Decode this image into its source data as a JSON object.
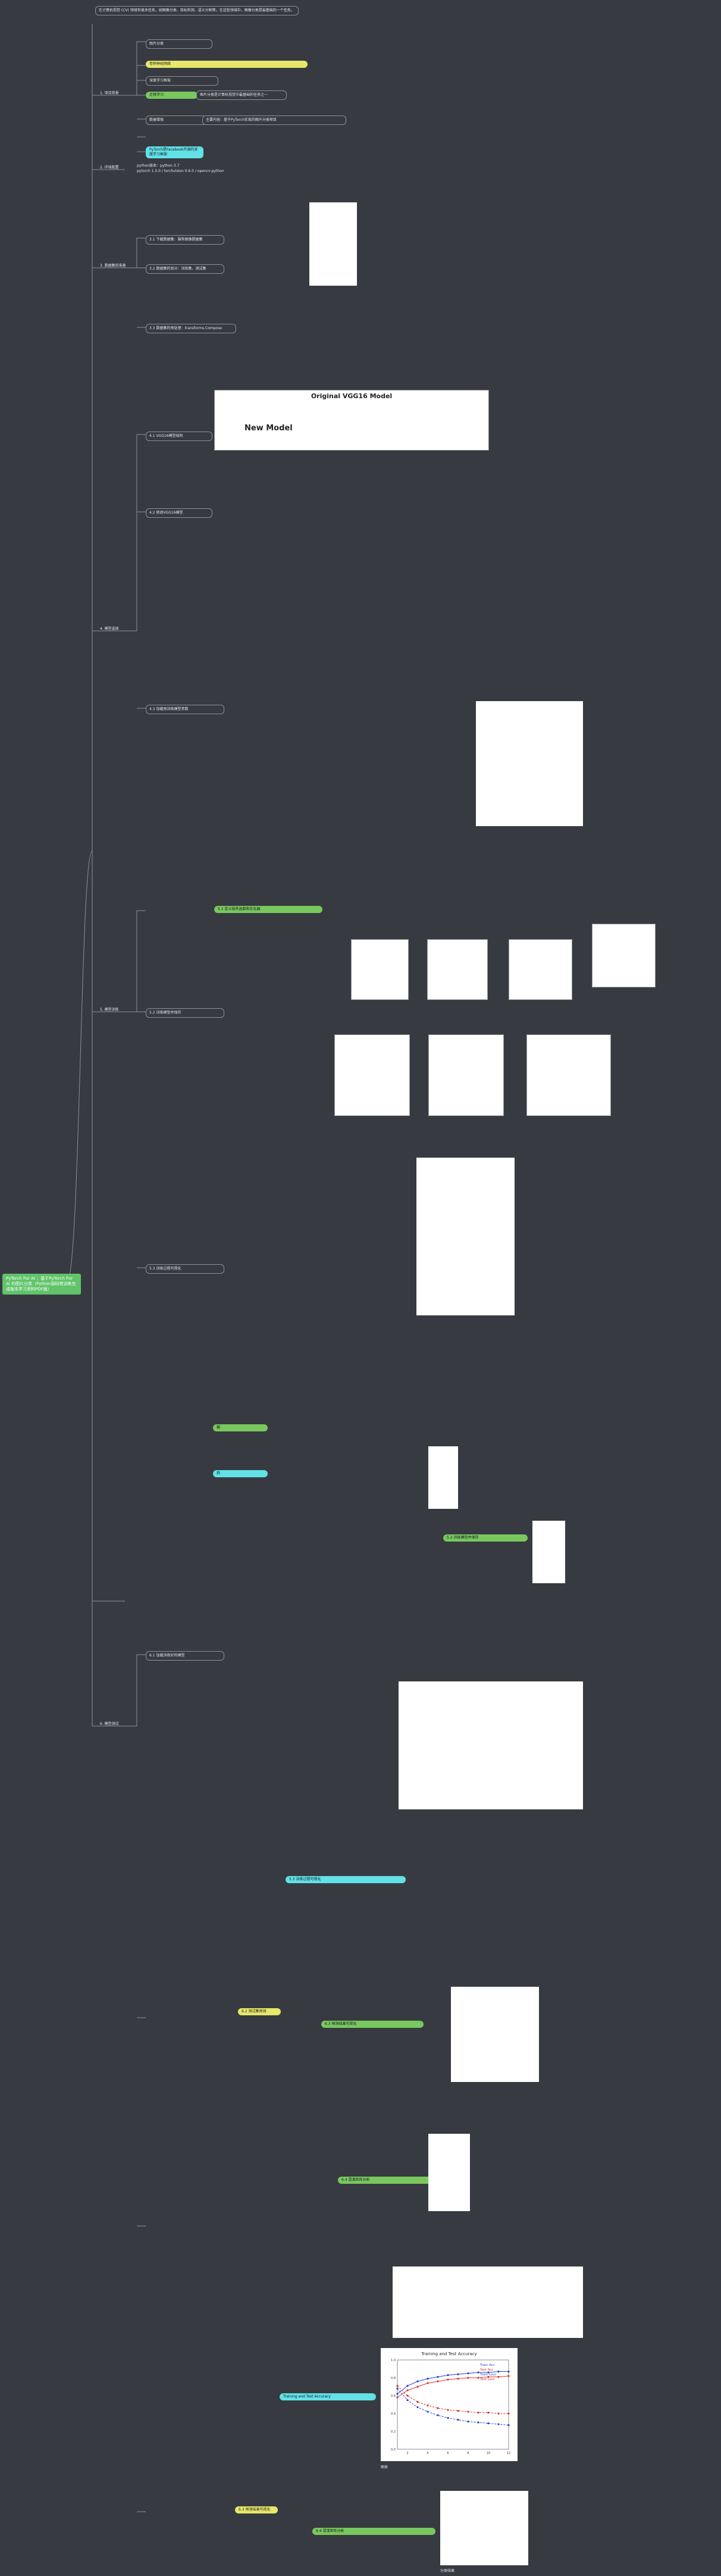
{
  "root_title": "PyTorch For AI ：基于PyTorch For AI 的图片分类（Python源码带训练完成版本学习资料PDF版）",
  "ch1": {
    "label": "1. 项目背景",
    "intro": "在计算机视觉 (CV) 领域有很多任务，如图像分类、目标检测、语义分割等。在这些领域中，图像分类是最基础的一个任务。",
    "points": [
      "图片分类",
      "卷积神经网络",
      "深度学习框架",
      "迁移学习",
      "数据增强"
    ],
    "desc_1": "图片分类是计算机视觉中最基础的任务之一",
    "desc_2": "主要内容：基于PyTorch实现的图片分类项目",
    "desc_3": "PyTorch是Facebook开源的深度学习框架"
  },
  "ch2": {
    "label": "2. 环境配置",
    "lines": [
      "python版本：python 3.7",
      "pytorch 1.5.0 / torchvision 0.6.0 / opencv-python"
    ]
  },
  "ch3": {
    "label": "3. 数据集的准备",
    "sub": [
      "3.1 下载数据集：猫狗图像数据集",
      "3.2 数据集的划分：训练集、测试集",
      "3.3 数据集的预处理：transforms.Compose"
    ]
  },
  "ch4": {
    "label": "4. 模型选择",
    "sub": [
      "4.1 VGG16模型结构",
      "4.2 修改VGG16模型",
      "4.3 加载预训练模型参数"
    ],
    "vgg_title": "Original VGG16 Model",
    "vgg_new": "New Model"
  },
  "ch5": {
    "label": "5. 模型训练",
    "sub": [
      "5.1 定义损失函数和优化器",
      "5.2 训练模型并保存",
      "5.3 训练过程可视化"
    ],
    "cat_label": "猫",
    "dog_label": "狗"
  },
  "ch6": {
    "label": "6. 模型测试",
    "sub": [
      "6.1 加载训练好的模型",
      "6.2 测试集预测",
      "6.3 预测结果可视化",
      "6.4 混淆矩阵分析"
    ],
    "chart_title": "Training and Test Accuracy",
    "legend": [
      "Train Acc",
      "Test Acc",
      "Train Loss",
      "Test Loss"
    ]
  },
  "captions": {
    "chart_caption": "图表",
    "table_caption": "运行结果",
    "grid_caption": "分类结果"
  },
  "chart_data": {
    "type": "line",
    "title": "Training and Test Accuracy",
    "xlabel": "",
    "ylabel": "",
    "series": [
      {
        "name": "Train Acc",
        "values": [
          0.62,
          0.71,
          0.76,
          0.79,
          0.81,
          0.83,
          0.84,
          0.85,
          0.86,
          0.86,
          0.87,
          0.87
        ]
      },
      {
        "name": "Test Acc",
        "values": [
          0.58,
          0.66,
          0.7,
          0.74,
          0.76,
          0.78,
          0.79,
          0.8,
          0.8,
          0.81,
          0.81,
          0.82
        ]
      },
      {
        "name": "Train Loss",
        "values": [
          0.68,
          0.55,
          0.47,
          0.42,
          0.38,
          0.35,
          0.33,
          0.31,
          0.3,
          0.29,
          0.28,
          0.27
        ]
      },
      {
        "name": "Test Loss",
        "values": [
          0.71,
          0.6,
          0.53,
          0.49,
          0.46,
          0.44,
          0.43,
          0.42,
          0.41,
          0.41,
          0.4,
          0.4
        ]
      }
    ],
    "x": [
      1,
      2,
      3,
      4,
      5,
      6,
      7,
      8,
      9,
      10,
      11,
      12
    ],
    "ylim": [
      0,
      1
    ]
  },
  "colors": {
    "bg": "#373b41",
    "line": "#8d9096",
    "yellow": "#e7e76a",
    "green": "#79c85e",
    "cyan": "#62e1e6",
    "root": "#61c46a"
  }
}
